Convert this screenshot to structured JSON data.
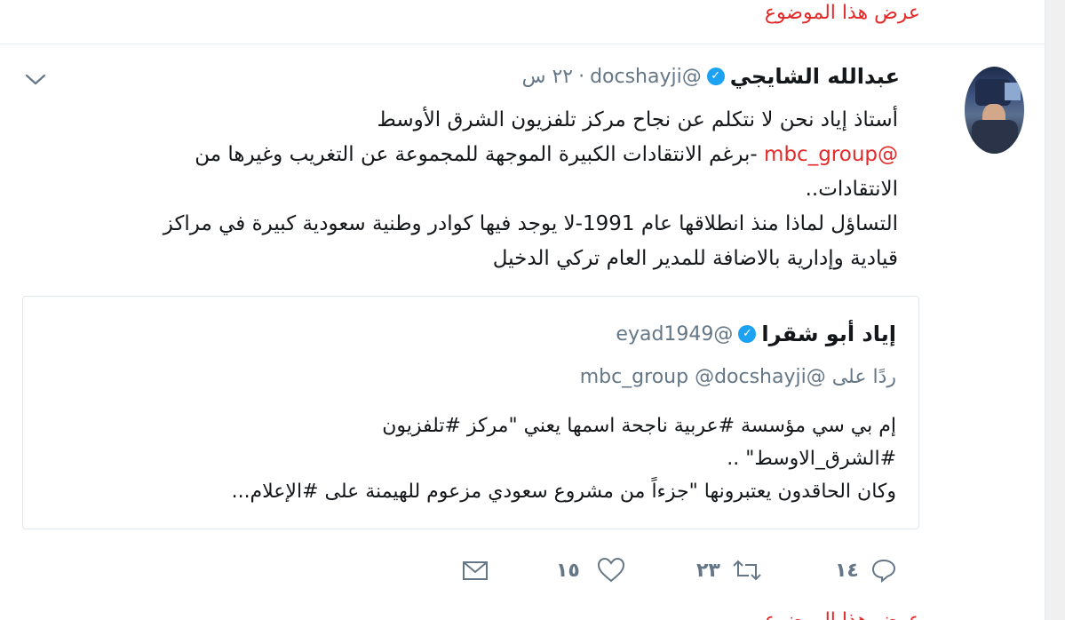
{
  "top_link": "عرض هذا الموضوع",
  "tweet": {
    "author_name": "عبدالله الشايجي",
    "handle": "@docshayji",
    "time_separator": "·",
    "time": "٢٢ س",
    "text_lines": [
      "أستاذ إياد نحن لا نتكلم عن نجاح مركز تلفزيون الشرق الأوسط",
      "-برغم الانتقادات الكبيرة الموجهة للمجموعة عن التغريب وغيرها من",
      "الانتقادات..",
      "التساؤل لماذا منذ انطلاقها عام 1991-لا يوجد فيها كوادر وطنية سعودية كبيرة في مراكز",
      "قيادية وإدارية بالاضافة للمدير العام تركي الدخيل"
    ],
    "mention": "@mbc_group",
    "replies_count": "١٤",
    "retweets_count": "٢٣",
    "likes_count": "١٥"
  },
  "quoted_tweet": {
    "author_name": "إياد أبو شقرا",
    "handle": "@eyad1949",
    "reply_prefix": "ردًا على",
    "reply_mentions": "@mbc_group @docshayji",
    "text_lines": [
      "إم بي سي مؤسسة #عربية ناجحة اسمها يعني \"مركز #تلفزيون",
      "#الشرق_الاوسط\" ..",
      "وكان الحاقدون يعتبرونها \"جزءاً من مشروع سعودي مزعوم للهيمنة على #الإعلام..."
    ]
  },
  "bottom_link": "عرض هذا الموضوع",
  "icons": {
    "caret": "chevron-down-icon",
    "reply": "reply-icon",
    "retweet": "retweet-icon",
    "like": "heart-icon",
    "dm": "envelope-icon",
    "verified": "verified-badge-icon"
  },
  "colors": {
    "link_red": "#e32a2a",
    "verified_blue": "#1da1f2",
    "muted_gray": "#657786"
  }
}
